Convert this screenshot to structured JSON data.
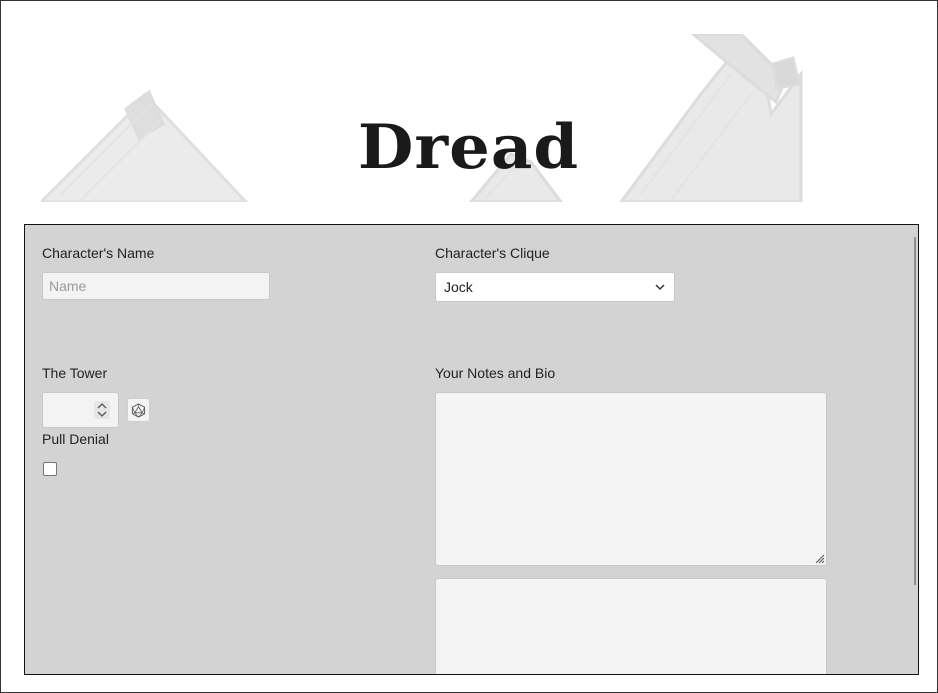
{
  "header": {
    "title": "Dread"
  },
  "sheet": {
    "name": {
      "label": "Character's Name",
      "placeholder": "Name",
      "value": ""
    },
    "clique": {
      "label": "Character's Clique",
      "selected": "Jock"
    },
    "tower": {
      "label": "The Tower",
      "value": ""
    },
    "pull_denial": {
      "label": "Pull Denial",
      "checked": false
    },
    "notes": {
      "label": "Your Notes and Bio",
      "value": ""
    },
    "notes_extra": {
      "value": ""
    }
  },
  "icons": {
    "dice": "d20-dice-icon",
    "select_arrow": "chevron-down-icon",
    "spinner": "spinner-arrows-icon",
    "resize": "resize-grip-icon"
  }
}
